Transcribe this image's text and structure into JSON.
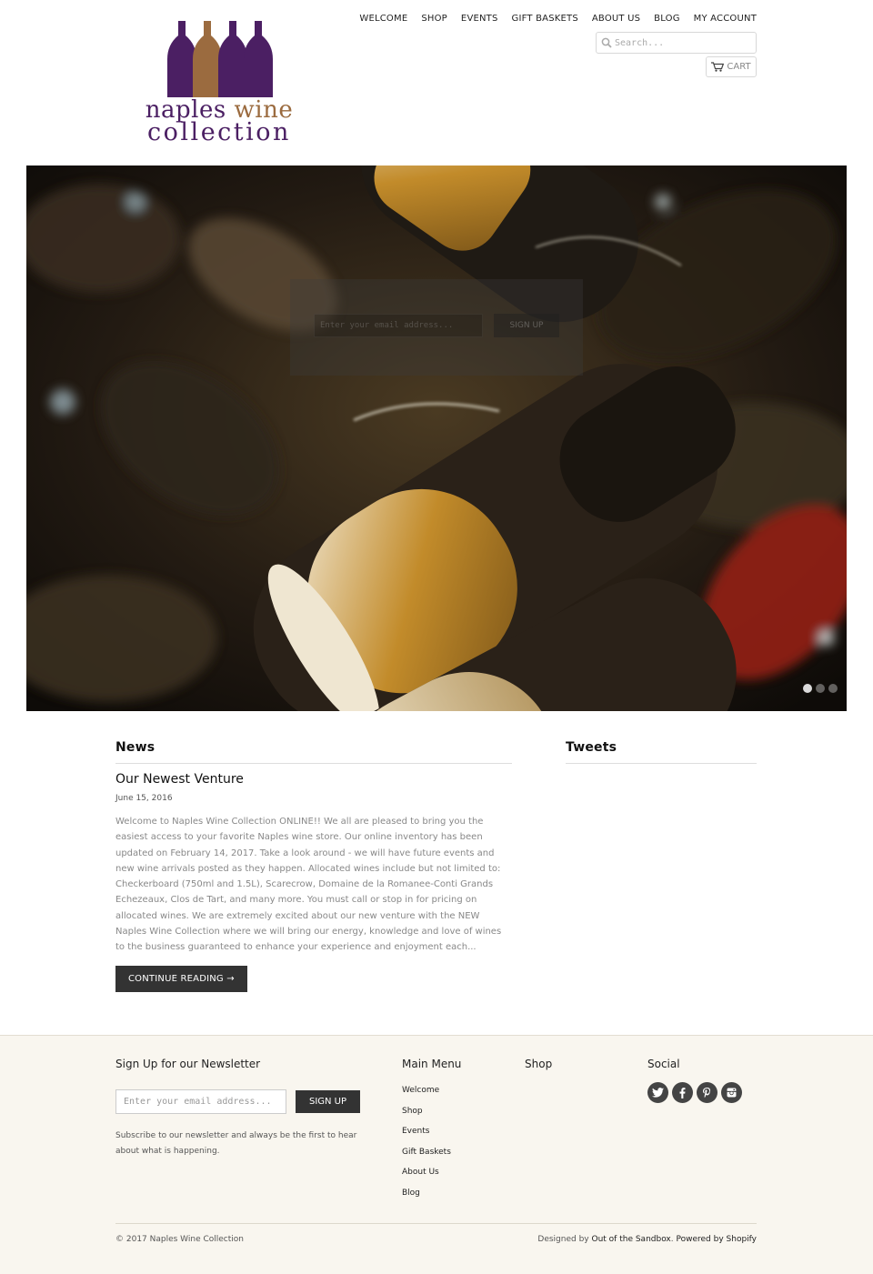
{
  "brand": {
    "logo_line1_a": "naples",
    "logo_line1_b": "wine",
    "logo_line2": "collection",
    "colors": {
      "purple": "#4b1f63",
      "brown": "#9b6b3f"
    }
  },
  "nav": {
    "items": [
      {
        "label": "WELCOME"
      },
      {
        "label": "SHOP"
      },
      {
        "label": "EVENTS"
      },
      {
        "label": "GIFT BASKETS"
      },
      {
        "label": "ABOUT US"
      },
      {
        "label": "BLOG"
      },
      {
        "label": "MY ACCOUNT"
      }
    ]
  },
  "search": {
    "placeholder": "Search...",
    "icon": "search-icon"
  },
  "cart": {
    "label": "CART",
    "icon": "cart-icon"
  },
  "hero": {
    "signup_placeholder": "Enter your email address...",
    "signup_button": "SIGN UP",
    "slides_total": 3,
    "active_slide": 1
  },
  "news": {
    "section_title": "News",
    "article": {
      "title": "Our Newest Venture",
      "date": "June 15, 2016",
      "body": "Welcome to Naples Wine Collection ONLINE!! We all are pleased to bring you the easiest access to your favorite Naples wine store. Our online inventory has been updated on February 14, 2017. Take a look around - we will have future events and new wine arrivals posted as they happen. Allocated wines include but not limited to: Checkerboard (750ml and 1.5L), Scarecrow, Domaine de la Romanee-Conti Grands Echezeaux, Clos de Tart, and many more. You must call or stop in for pricing on allocated wines. We are extremely excited about our new venture with the NEW Naples Wine Collection where we will bring our energy, knowledge and love of wines to the business guaranteed to enhance your experience and enjoyment each...",
      "continue_label": "CONTINUE READING →"
    }
  },
  "tweets": {
    "section_title": "Tweets"
  },
  "footer": {
    "newsletter": {
      "title": "Sign Up for our Newsletter",
      "placeholder": "Enter your email address...",
      "button": "SIGN UP",
      "description": "Subscribe to our newsletter and always be the first to hear about what is happening."
    },
    "main_menu": {
      "title": "Main Menu",
      "items": [
        "Welcome",
        "Shop",
        "Events",
        "Gift Baskets",
        "About Us",
        "Blog"
      ]
    },
    "shop": {
      "title": "Shop"
    },
    "social": {
      "title": "Social",
      "icons": [
        "twitter-icon",
        "facebook-icon",
        "pinterest-icon",
        "instagram-icon"
      ]
    },
    "copyright": "© 2017 Naples Wine Collection",
    "credit_prefix": "Designed by",
    "credit_designer": "Out of the Sandbox",
    "credit_powered": "Powered by Shopify"
  }
}
